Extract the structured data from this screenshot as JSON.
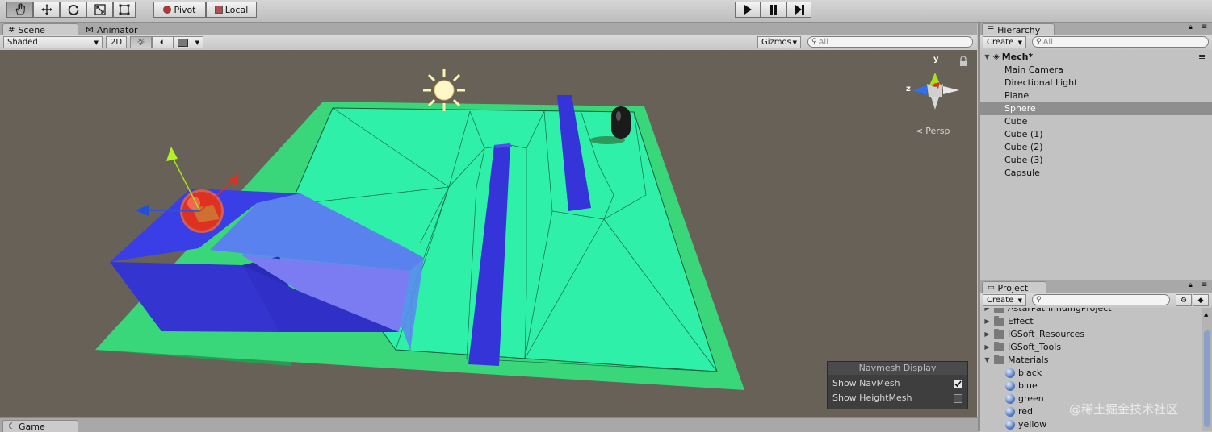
{
  "toolbar": {
    "tools": [
      "hand-icon",
      "move-icon",
      "rotate-icon",
      "scale-icon",
      "rect-icon"
    ],
    "pivot_label": "Pivot",
    "local_label": "Local",
    "play_icon": "play-icon",
    "pause_icon": "pause-icon",
    "step_icon": "step-icon"
  },
  "scene_panel": {
    "tabs": [
      {
        "label": "Scene",
        "icon": "scene-icon"
      },
      {
        "label": "Animator",
        "icon": "animator-icon"
      }
    ],
    "shading_mode": "Shaded",
    "mode_2d": "2D",
    "gizmos_label": "Gizmos",
    "search_placeholder": "All",
    "persp_label": "Persp",
    "axis_y": "y",
    "axis_z": "z"
  },
  "navmesh_display": {
    "title": "Navmesh Display",
    "options": [
      {
        "label": "Show NavMesh",
        "checked": true
      },
      {
        "label": "Show HeightMesh",
        "checked": false
      }
    ]
  },
  "hierarchy": {
    "tab_label": "Hierarchy",
    "create_label": "Create",
    "search_placeholder": "All",
    "scene_name": "Mech*",
    "items": [
      "Main Camera",
      "Directional Light",
      "Plane",
      "Sphere",
      "Cube",
      "Cube (1)",
      "Cube (2)",
      "Cube (3)",
      "Capsule"
    ],
    "selected": "Sphere"
  },
  "project": {
    "tab_label": "Project",
    "create_label": "Create",
    "folders": [
      {
        "label": "AstarPathfindingProject",
        "expanded": false
      },
      {
        "label": "Effect",
        "expanded": false
      },
      {
        "label": "IGSoft_Resources",
        "expanded": false
      },
      {
        "label": "IGSoft_Tools",
        "expanded": false
      },
      {
        "label": "Materials",
        "expanded": true
      }
    ],
    "materials": [
      "black",
      "blue",
      "green",
      "red",
      "yellow"
    ]
  },
  "bottom": {
    "game_tab": "Game"
  },
  "watermark": "@稀土掘金技术社区",
  "colors": {
    "navmesh": "#2ef0a8",
    "plane": "#3ad67a",
    "cube": "#3c3ce0",
    "sphere": "#e03020",
    "scene_bg": "#676158",
    "selection": "#8e8e8e"
  }
}
